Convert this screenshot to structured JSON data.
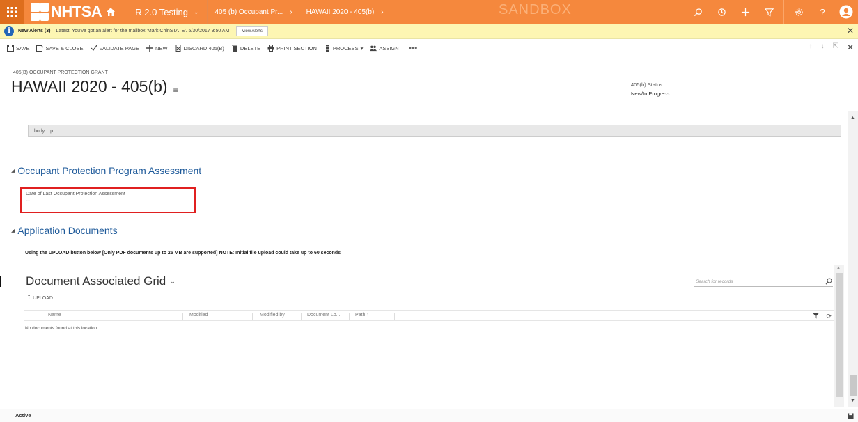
{
  "nav": {
    "logo_text": "NHTSA",
    "app_name": "R 2.0 Testing",
    "crumb1": "405 (b) Occupant Pr...",
    "crumb2": "HAWAII 2020 - 405(b)",
    "sandbox_label": "SANDBOX"
  },
  "alert": {
    "title": "New Alerts (3)",
    "message": "Latest: You've got an alert for the mailbox 'Mark ChinSTATE'. 5/30/2017 9:50 AM",
    "button": "View Alerts"
  },
  "commands": {
    "save": "SAVE",
    "save_close": "SAVE & CLOSE",
    "validate": "VALIDATE PAGE",
    "new": "NEW",
    "discard": "DISCARD 405(B)",
    "delete": "DELETE",
    "print": "PRINT SECTION",
    "process": "PROCESS",
    "assign": "ASSIGN",
    "more": "•••"
  },
  "header": {
    "entity_type": "405(B) OCCUPANT PROTECTION GRANT",
    "title": "HAWAII 2020 - 405(b)",
    "status_label": "405(b) Status",
    "status_value_main": "New/In Progre",
    "status_value_fade": "ss"
  },
  "editor": {
    "path1": "body",
    "path2": "p"
  },
  "sections": {
    "assessment_title": "Occupant Protection Program Assessment",
    "documents_title": "Application Documents"
  },
  "assessment": {
    "field_label": "Date of Last Occupant Protection Assessment",
    "field_value": "--"
  },
  "documents": {
    "upload_note": "Using the UPLOAD button below [Only PDF documents up to 25 MB are supported] NOTE: Initial file upload could take up to 60 seconds",
    "grid_title": "Document Associated Grid",
    "search_placeholder": "Search for records",
    "upload_label": "UPLOAD",
    "columns": [
      "Name",
      "Modified",
      "Modified by",
      "Document Lo...",
      "Path ↑"
    ],
    "empty_message": "No documents found at this location."
  },
  "footer": {
    "status": "Active"
  }
}
